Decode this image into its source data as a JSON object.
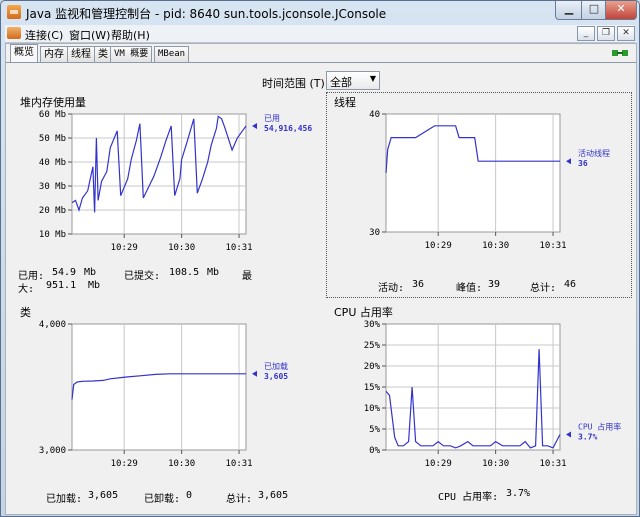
{
  "window": {
    "title": "Java 监视和管理控制台 - pid: 8640 sun.tools.jconsole.JConsole"
  },
  "menu": {
    "items": [
      "连接(C)",
      "窗口(W)",
      "帮助(H)"
    ]
  },
  "tabs": [
    {
      "label": "概览",
      "active": true
    },
    {
      "label": "内存",
      "active": false
    },
    {
      "label": "线程",
      "active": false
    },
    {
      "label": "类",
      "active": false
    },
    {
      "label": "VM 概要",
      "active": false
    },
    {
      "label": "MBean",
      "active": false
    }
  ],
  "time_range": {
    "label": "时间范围 (T):",
    "value": "全部"
  },
  "colors": {
    "series": "#3333cc",
    "grid": "#c8c8c8",
    "plot_bg": "#ffffff"
  },
  "panels": {
    "heap": {
      "title": "堆内存使用量",
      "stats": {
        "used_label": "已用:",
        "used_value": "54.9",
        "used_unit": "Mb",
        "committed_label": "已提交:",
        "committed_value": "108.5",
        "committed_unit": "Mb",
        "max_label_a": "最",
        "max_label_b": "大:",
        "max_value": "951.1",
        "max_unit": "Mb"
      }
    },
    "threads": {
      "title": "线程",
      "stats": {
        "live_label": "活动:",
        "live_value": "36",
        "peak_label": "峰值:",
        "peak_value": "39",
        "total_label": "总计:",
        "total_value": "46"
      }
    },
    "classes": {
      "title": "类",
      "stats": {
        "loaded_label": "已加载:",
        "loaded_value": "3,605",
        "unloaded_label": "已卸载:",
        "unloaded_value": "0",
        "total_label": "总计:",
        "total_value": "3,605"
      }
    },
    "cpu": {
      "title": "CPU 占用率",
      "stats": {
        "label": "CPU 占用率:",
        "value": "3.7%"
      }
    }
  },
  "chart_data": [
    {
      "type": "line",
      "title": "堆内存使用量",
      "y_ticks": [
        "60 Mb",
        "50 Mb",
        "40 Mb",
        "30 Mb",
        "20 Mb",
        "10 Mb"
      ],
      "ylim": [
        10,
        60
      ],
      "x_ticks": [
        "10:29",
        "10:30",
        "10:31"
      ],
      "xlim": [
        0,
        100
      ],
      "tick_x": [
        30,
        63,
        96
      ],
      "series": [
        {
          "name": "已用",
          "label_value": "54,916,456",
          "x": [
            0,
            2,
            4,
            6,
            9,
            12,
            13,
            14,
            15,
            17,
            20,
            22,
            26,
            28,
            32,
            34,
            37,
            39,
            41,
            43,
            47,
            51,
            54,
            57,
            59,
            62,
            63,
            66,
            70,
            72,
            75,
            78,
            80,
            83,
            84,
            86,
            88,
            92,
            95,
            98,
            100
          ],
          "y": [
            23,
            24,
            20,
            25,
            28,
            38,
            19,
            50,
            24,
            32,
            36,
            46,
            53,
            26,
            33,
            41,
            49,
            56,
            25,
            28,
            34,
            42,
            49,
            55,
            26,
            33,
            41,
            48,
            58,
            27,
            33,
            40,
            47,
            54,
            59,
            58,
            54,
            45,
            50,
            53,
            55
          ]
        }
      ]
    },
    {
      "type": "line",
      "title": "线程",
      "y_ticks": [
        "40",
        "30"
      ],
      "ylim": [
        30,
        40
      ],
      "x_ticks": [
        "10:29",
        "10:30",
        "10:31"
      ],
      "xlim": [
        0,
        100
      ],
      "tick_x": [
        30,
        63,
        96
      ],
      "series": [
        {
          "name": "活动线程",
          "label_value": "36",
          "x": [
            0,
            1,
            3,
            15,
            17,
            28,
            30,
            40,
            42,
            44,
            51,
            53,
            56,
            100
          ],
          "y": [
            35,
            37,
            38,
            38,
            38,
            39,
            39,
            39,
            38,
            38,
            38,
            36,
            36,
            36
          ]
        }
      ]
    },
    {
      "type": "line",
      "title": "类",
      "y_ticks": [
        "4,000",
        "3,000"
      ],
      "ylim": [
        3000,
        4000
      ],
      "x_ticks": [
        "10:29",
        "10:30",
        "10:31"
      ],
      "xlim": [
        0,
        100
      ],
      "tick_x": [
        30,
        63,
        96
      ],
      "series": [
        {
          "name": "已加载",
          "label_value": "3,605",
          "x": [
            0,
            1,
            3,
            6,
            12,
            18,
            22,
            28,
            32,
            40,
            48,
            56,
            64,
            72,
            80,
            88,
            100
          ],
          "y": [
            3400,
            3520,
            3540,
            3545,
            3548,
            3552,
            3565,
            3575,
            3580,
            3590,
            3600,
            3605,
            3605,
            3605,
            3605,
            3605,
            3605
          ]
        }
      ]
    },
    {
      "type": "line",
      "title": "CPU 占用率",
      "y_ticks": [
        "30%",
        "25%",
        "20%",
        "15%",
        "10%",
        "5%",
        "0%"
      ],
      "ylim": [
        0,
        30
      ],
      "x_ticks": [
        "10:29",
        "10:30",
        "10:31"
      ],
      "xlim": [
        0,
        100
      ],
      "tick_x": [
        30,
        63,
        96
      ],
      "series": [
        {
          "name": "CPU 占用率",
          "label_value": "3.7%",
          "x": [
            0,
            2,
            5,
            7,
            10,
            13,
            15,
            17,
            20,
            23,
            27,
            30,
            33,
            37,
            40,
            43,
            47,
            50,
            53,
            57,
            60,
            63,
            67,
            70,
            74,
            77,
            80,
            83,
            86,
            88,
            90,
            93,
            96,
            100
          ],
          "y": [
            14,
            13,
            3,
            1,
            1,
            2,
            15,
            2,
            1,
            1,
            1,
            2,
            1,
            1,
            0.5,
            1,
            2,
            1,
            1,
            1,
            1,
            2,
            1,
            1,
            1,
            1,
            2,
            0.5,
            1,
            24,
            1,
            1,
            0.5,
            3.7
          ]
        }
      ]
    }
  ]
}
